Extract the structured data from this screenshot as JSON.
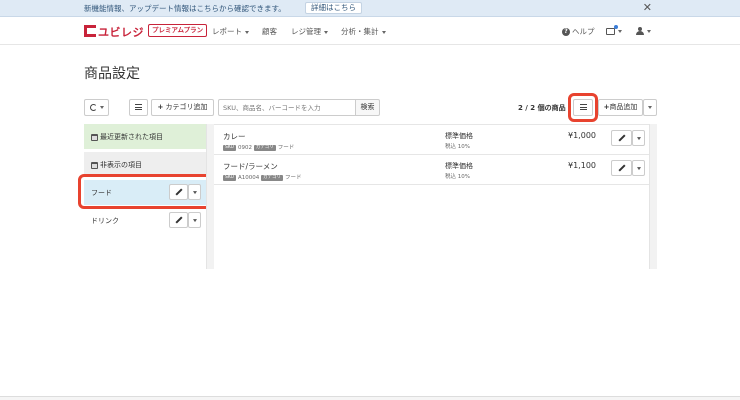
{
  "notice": {
    "text": "新機能情報、アップデート情報はこちらから確認できます。",
    "link_label": "詳細はこちら",
    "close_glyph": "✕"
  },
  "navbar": {
    "logo_text": "ユビレジ",
    "plan_badge": "プレミアムプラン",
    "menu": [
      "レポート",
      "顧客",
      "レジ管理",
      "分析・集計"
    ],
    "help_label": "ヘルプ"
  },
  "page": {
    "title": "商品設定"
  },
  "toolbar": {
    "add_category_label": "カテゴリ追加",
    "search_placeholder": "SKU、商品名、バーコードを入力",
    "search_button": "検索",
    "count_text": "2 / 2 個の商品",
    "add_product_label": "商品追加"
  },
  "categories": [
    {
      "label": "最近更新された項目"
    },
    {
      "label": "非表示の項目"
    },
    {
      "label": "フード"
    },
    {
      "label": "ドリンク"
    }
  ],
  "products": [
    {
      "name": "カレー",
      "sku_tag": "SKU",
      "sku": "0902",
      "category_tag": "カテゴリ",
      "category": "フード",
      "price_label": "標準価格",
      "tax": "税込 10%",
      "price": "¥1,000"
    },
    {
      "name": "フード/ラーメン",
      "sku_tag": "SKU",
      "sku": "A10004",
      "category_tag": "カテゴリ",
      "category": "フード",
      "price_label": "標準価格",
      "tax": "税込 10%",
      "price": "¥1,100"
    }
  ],
  "colors": {
    "brand": "#c8233a",
    "highlight": "#e8432f",
    "selected_category": "#d9edf7",
    "recent_category": "#dff0d8"
  }
}
